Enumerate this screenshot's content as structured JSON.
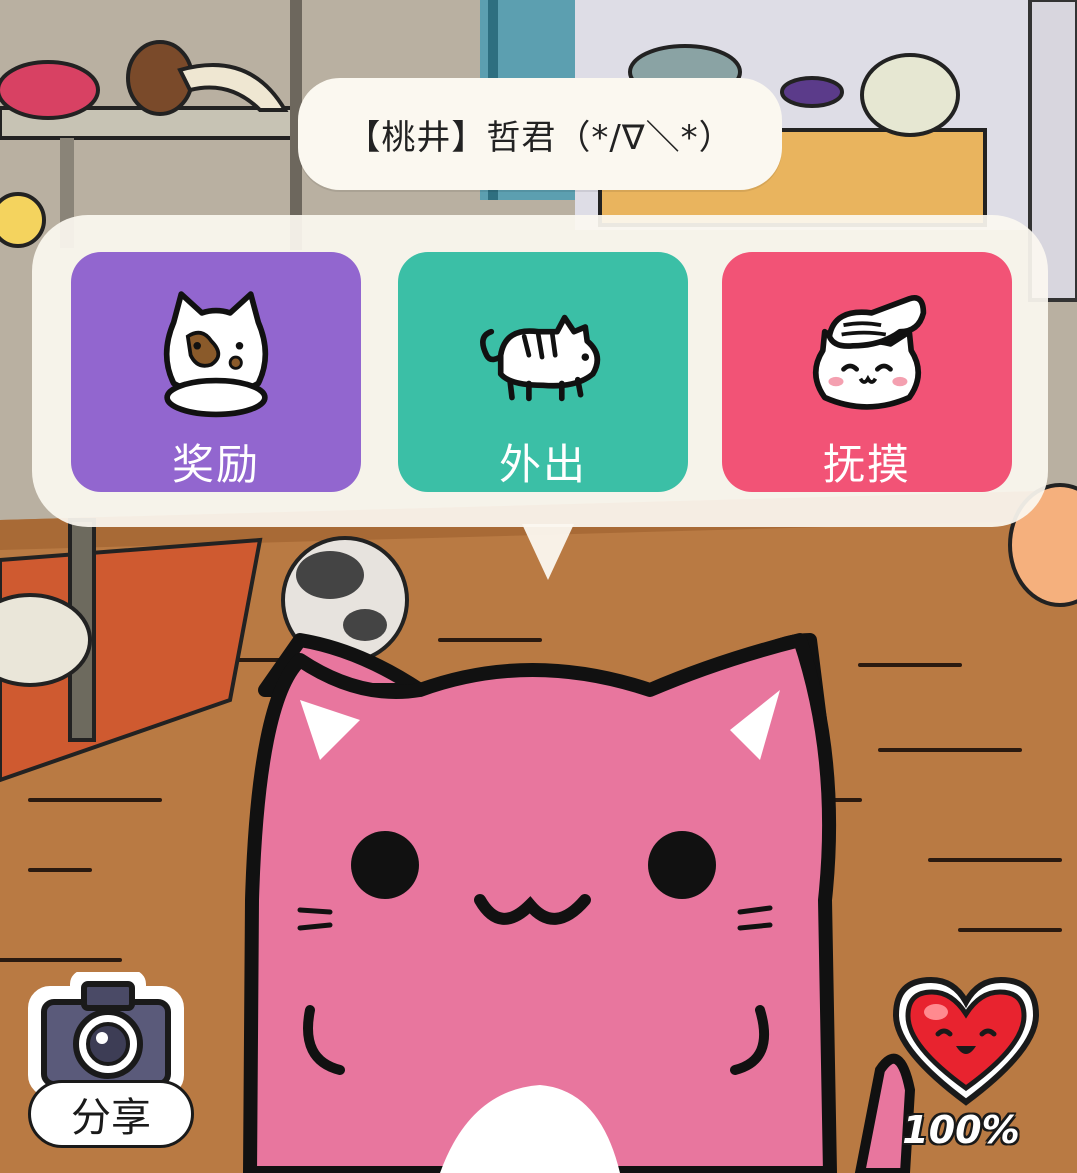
{
  "cat_name": "【桃井】哲君（*/∇＼*）",
  "actions": [
    {
      "label": "奖励",
      "icon": "fed-cat-icon",
      "color": "#9266cf"
    },
    {
      "label": "外出",
      "icon": "walking-cat-icon",
      "color": "#3bbfa6"
    },
    {
      "label": "抚摸",
      "icon": "petting-hand-cat-icon",
      "color": "#f25376"
    }
  ],
  "share": {
    "label": "分享",
    "icon": "camera-icon"
  },
  "affection": {
    "value": "100%",
    "icon": "smiling-heart-icon",
    "fraction": 1.0
  }
}
